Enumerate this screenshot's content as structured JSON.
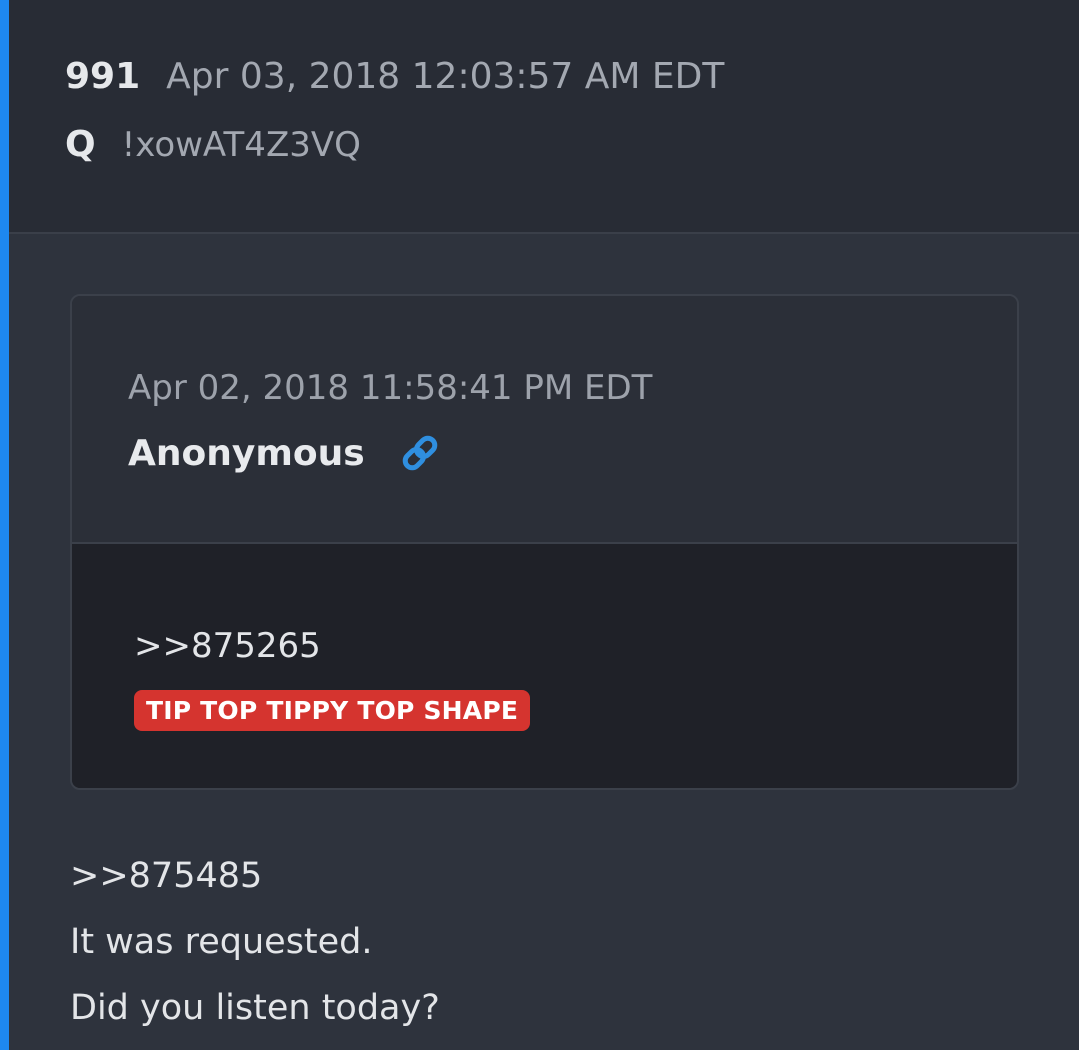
{
  "post": {
    "number": "991",
    "timestamp": "Apr 03, 2018 12:03:57 AM EDT",
    "author": "Q",
    "tripcode": "!xowAT4Z3VQ"
  },
  "quoted_post": {
    "timestamp": "Apr 02, 2018 11:58:41 PM EDT",
    "author": "Anonymous",
    "link_icon": "link-icon",
    "reference": ">>875265",
    "badge": "TIP TOP TIPPY TOP SHAPE"
  },
  "body": {
    "lines": [
      ">>875485",
      "It was requested.",
      "Did you listen today?"
    ]
  },
  "colors": {
    "accent": "#1e88f0",
    "badge": "#d5342f",
    "link": "#2f8fe0"
  }
}
